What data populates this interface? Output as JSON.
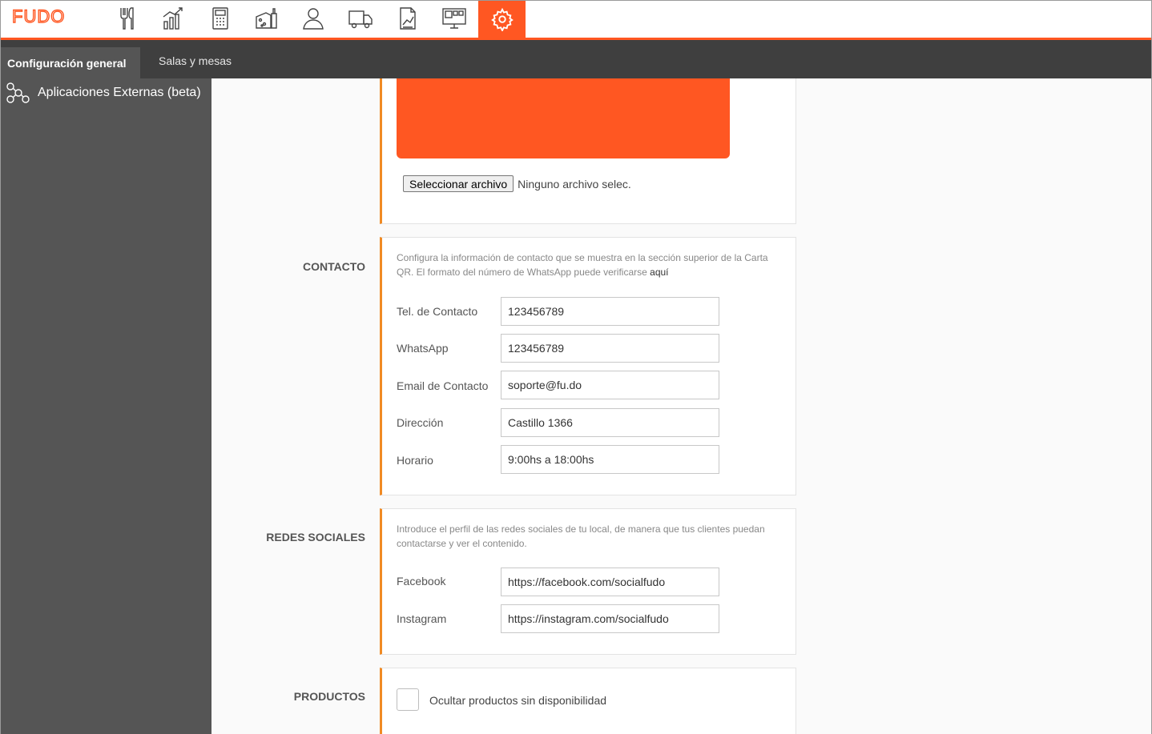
{
  "brand": {
    "logo_text": "FUDO",
    "accent_color": "#ff5722"
  },
  "top_nav": {
    "icons": [
      "fork-knife-icon",
      "bar-chart-icon",
      "calculator-icon",
      "products-icon",
      "user-icon",
      "truck-icon",
      "report-icon",
      "monitor-icon",
      "gear-icon"
    ],
    "active": "gear-icon"
  },
  "sub_tabs": {
    "general": "Configuración general",
    "rooms": "Salas y mesas"
  },
  "sidebar": {
    "items": [
      {
        "label": "Aplicaciones Externas (beta)",
        "icon": "nodes-icon"
      }
    ]
  },
  "upload": {
    "button_label": "Seleccionar archivo",
    "status_text": "Ninguno archivo selec."
  },
  "contact": {
    "section_title": "CONTACTO",
    "description": "Configura la información de contacto que se muestra en la sección superior de la Carta QR. El formato del número de WhatsApp puede verificarse ",
    "link_text": "aquí",
    "fields": [
      {
        "label": "Tel. de Contacto",
        "value": "123456789"
      },
      {
        "label": "WhatsApp",
        "value": "123456789"
      },
      {
        "label": "Email de Contacto",
        "value": "soporte@fu.do"
      },
      {
        "label": "Dirección",
        "value": "Castillo 1366"
      },
      {
        "label": "Horario",
        "value": "9:00hs a 18:00hs"
      }
    ]
  },
  "social": {
    "section_title": "REDES SOCIALES",
    "description": "Introduce el perfil de las redes sociales de tu local, de manera que tus clientes puedan contactarse y ver el contenido.",
    "fields": [
      {
        "label": "Facebook",
        "value": "https://facebook.com/socialfudo"
      },
      {
        "label": "Instagram",
        "value": "https://instagram.com/socialfudo"
      }
    ]
  },
  "products": {
    "section_title": "PRODUCTOS",
    "checkbox_label": "Ocultar productos sin disponibilidad",
    "checked": false
  }
}
